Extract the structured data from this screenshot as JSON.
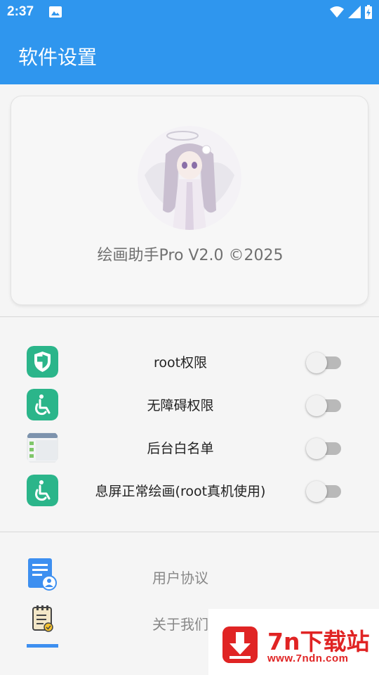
{
  "status_bar": {
    "time": "2:37"
  },
  "app_bar": {
    "title": "软件设置"
  },
  "profile": {
    "version_text": "绘画助手Pro V2.0 ©2025"
  },
  "settings": [
    {
      "label": "root权限",
      "icon": "shield-icon",
      "enabled": false
    },
    {
      "label": "无障碍权限",
      "icon": "accessibility-icon",
      "enabled": false
    },
    {
      "label": "后台白名单",
      "icon": "app-window-icon",
      "enabled": false
    },
    {
      "label": "息屏正常绘画(root真机使用)",
      "icon": "accessibility-icon",
      "enabled": false
    }
  ],
  "links": [
    {
      "label": "用户协议",
      "icon": "user-document-icon"
    },
    {
      "label": "关于我们",
      "icon": "clipboard-check-icon"
    }
  ],
  "watermark": {
    "name": "7n下载站",
    "url": "www.7ndn.com"
  },
  "colors": {
    "primary": "#2f96ee",
    "icon_green": "#2bb58a",
    "watermark_red": "#e02424"
  }
}
